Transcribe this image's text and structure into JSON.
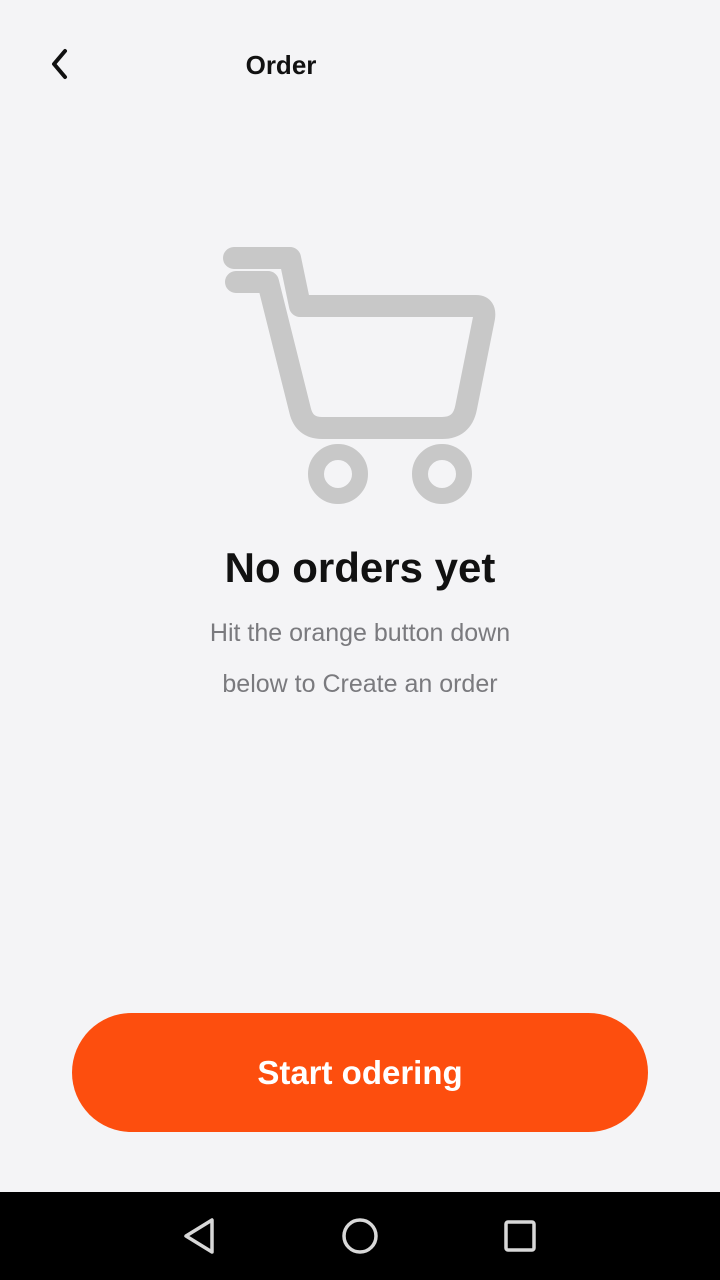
{
  "header": {
    "title": "Order",
    "back_icon": "chevron-left-icon"
  },
  "empty_state": {
    "icon": "shopping-cart-icon",
    "icon_color": "#c8c8c8",
    "title": "No orders yet",
    "description_line1": "Hit the orange button down",
    "description_line2": "below to Create an order"
  },
  "actions": {
    "start_label": "Start odering",
    "start_color": "#fd4e0e"
  },
  "system_nav": {
    "back_icon": "triangle-back-icon",
    "home_icon": "circle-home-icon",
    "recents_icon": "square-recents-icon"
  }
}
